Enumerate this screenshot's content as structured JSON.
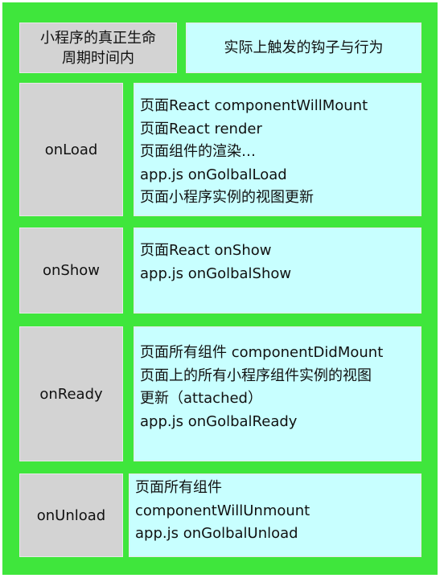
{
  "header": {
    "left_lines": [
      "小程序的真正生命",
      "周期时间内"
    ],
    "right": "实际上触发的钩子与行为"
  },
  "rows": [
    {
      "hook": "onLoad",
      "lines": [
        "页面React componentWillMount",
        "页面React render",
        "页面组件的渲染…",
        "app.js onGolbalLoad",
        "页面小程序实例的视图更新"
      ]
    },
    {
      "hook": "onShow",
      "lines": [
        "页面React onShow",
        "app.js onGolbalShow"
      ]
    },
    {
      "hook": "onReady",
      "lines": [
        "页面所有组件 componentDidMount",
        "页面上的所有小程序组件实例的视图",
        "更新（attached）",
        "app.js onGolbalReady"
      ]
    },
    {
      "hook": "onUnload",
      "lines": [
        "页面所有组件",
        "componentWillUnmount",
        "app.js onGolbalUnload"
      ]
    }
  ],
  "colors": {
    "frame": "#3fe63c",
    "left_cell": "#d3d3d3",
    "right_cell": "#c8ffff"
  }
}
